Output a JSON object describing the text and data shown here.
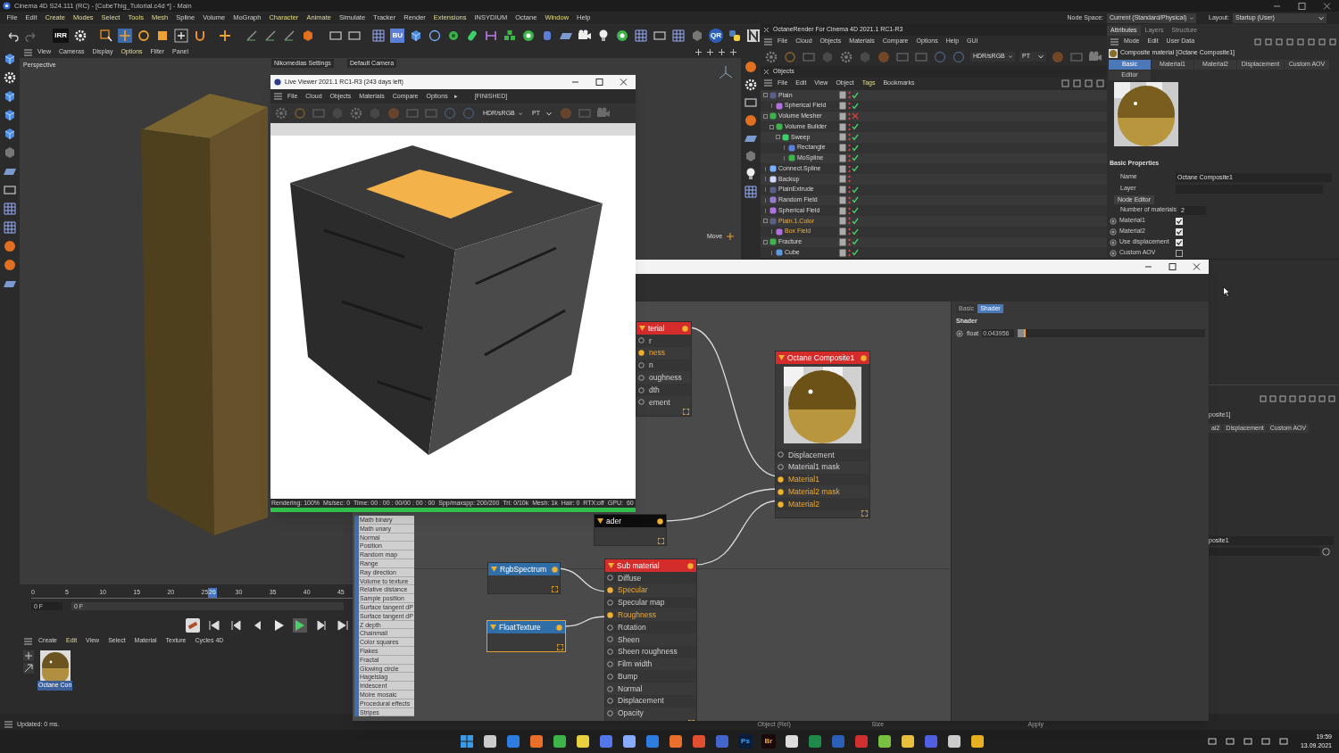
{
  "window": {
    "title": "Cinema 4D S24.111 (RC) - [CubeThig_Tutorial.c4d *] - Main"
  },
  "menu_bar": {
    "items": [
      {
        "label": "File",
        "highlight": false
      },
      {
        "label": "Edit",
        "highlight": false
      },
      {
        "label": "Create",
        "highlight": true
      },
      {
        "label": "Modes",
        "highlight": true
      },
      {
        "label": "Select",
        "highlight": true
      },
      {
        "label": "Tools",
        "highlight": true
      },
      {
        "label": "Mesh",
        "highlight": true
      },
      {
        "label": "Spline",
        "highlight": false
      },
      {
        "label": "Volume",
        "highlight": false
      },
      {
        "label": "MoGraph",
        "highlight": false
      },
      {
        "label": "Character",
        "highlight": true
      },
      {
        "label": "Animate",
        "highlight": true
      },
      {
        "label": "Simulate",
        "highlight": false
      },
      {
        "label": "Tracker",
        "highlight": false
      },
      {
        "label": "Render",
        "highlight": false
      },
      {
        "label": "Extensions",
        "highlight": true
      },
      {
        "label": "INSYDIUM",
        "highlight": false
      },
      {
        "label": "Octane",
        "highlight": false
      },
      {
        "label": "Window",
        "highlight": true
      },
      {
        "label": "Help",
        "highlight": false
      }
    ],
    "node_space_label": "Node Space:",
    "node_space": "Current (Standard/Physical)",
    "layout_label": "Layout:",
    "layout": "Startup (User)"
  },
  "toolbar": {
    "badges": [
      "IRR",
      "BU",
      "QR"
    ]
  },
  "viewport": {
    "menu": [
      {
        "label": "View",
        "highlight": false
      },
      {
        "label": "Cameras",
        "highlight": false
      },
      {
        "label": "Display",
        "highlight": false
      },
      {
        "label": "Options",
        "highlight": true
      },
      {
        "label": "Filter",
        "highlight": false
      },
      {
        "label": "Panel",
        "highlight": false
      }
    ],
    "camera": "Perspective",
    "tabs": [
      "Nikomedias Settings",
      "Default Camera"
    ],
    "move_label": "Move"
  },
  "timeline": {
    "ticks": [
      "0",
      "5",
      "10",
      "15",
      "20",
      "25",
      "30",
      "35",
      "40",
      "45"
    ],
    "current_frame": "26",
    "playhead": {
      "level": 0.52
    },
    "start_field": "0 F",
    "range_field": "0 F"
  },
  "material_manager": {
    "menu": [
      {
        "label": "Create",
        "highlight": false
      },
      {
        "label": "Edit",
        "highlight": true
      },
      {
        "label": "View",
        "highlight": false
      },
      {
        "label": "Select",
        "highlight": false
      },
      {
        "label": "Material",
        "highlight": false
      },
      {
        "label": "Texture",
        "highlight": false
      },
      {
        "label": "Cycles 4D",
        "highlight": false
      }
    ],
    "materials": [
      {
        "name": "Octane Con",
        "selected": true
      }
    ]
  },
  "status_bar": {
    "text": "Updated: 0 ms.",
    "coordinates": [
      "Object (Rel)",
      "Size",
      "Apply"
    ]
  },
  "octane_panel": {
    "title": "OctaneRender For Cinema 4D 2021.1 RC1-R3",
    "menu": [
      "File",
      "Cloud",
      "Objects",
      "Materials",
      "Compare",
      "Options",
      "Help",
      "GUI"
    ],
    "display_mode": "HDR/sRGB",
    "kernel": "PT"
  },
  "objects": {
    "title": "Objects",
    "menu": [
      {
        "label": "File",
        "highlight": false
      },
      {
        "label": "Edit",
        "highlight": false
      },
      {
        "label": "View",
        "highlight": false
      },
      {
        "label": "Object",
        "highlight": false
      },
      {
        "label": "Tags",
        "highlight": true
      },
      {
        "label": "Bookmarks",
        "highlight": false
      }
    ],
    "tree": [
      {
        "name": "Plain",
        "kind": "plain",
        "selected": false,
        "checked": true,
        "disabled": false,
        "children": [
          {
            "name": "Spherical Field",
            "kind": "sphere",
            "selected": false,
            "checked": true,
            "disabled": false
          }
        ]
      },
      {
        "name": "Volume Mesher",
        "kind": "mesher",
        "selected": false,
        "checked": false,
        "disabled": true,
        "children": [
          {
            "name": "Volume Builder",
            "kind": "mesher",
            "selected": false,
            "checked": true,
            "disabled": false,
            "children": [
              {
                "name": "Sweep",
                "kind": "sweep",
                "selected": false,
                "checked": true,
                "disabled": false,
                "children": [
                  {
                    "name": "Rectangle",
                    "kind": "rectangle",
                    "selected": false,
                    "checked": true,
                    "disabled": false
                  },
                  {
                    "name": "MoSpline",
                    "kind": "mospline",
                    "selected": false,
                    "checked": true,
                    "disabled": false
                  }
                ]
              }
            ]
          }
        ]
      },
      {
        "name": "Connect.Spline",
        "kind": "spline",
        "selected": false,
        "checked": true,
        "disabled": false
      },
      {
        "name": "Backup",
        "kind": "null",
        "selected": false,
        "checked": false,
        "disabled": false
      },
      {
        "name": "PlainExtrude",
        "kind": "plain",
        "selected": false,
        "checked": true,
        "disabled": false
      },
      {
        "name": "Random Field",
        "kind": "random",
        "selected": false,
        "checked": true,
        "disabled": false
      },
      {
        "name": "Spherical Field",
        "kind": "sphere",
        "selected": false,
        "checked": true,
        "disabled": false
      },
      {
        "name": "Plain.1.Color",
        "kind": "plain",
        "selected": true,
        "checked": true,
        "disabled": false,
        "children": [
          {
            "name": "Box Field",
            "kind": "box",
            "selected": true,
            "checked": true,
            "disabled": false
          }
        ]
      },
      {
        "name": "Fracture",
        "kind": "fracture",
        "selected": false,
        "checked": true,
        "disabled": false,
        "children": [
          {
            "name": "Cube",
            "kind": "cube",
            "selected": false,
            "checked": true,
            "disabled": false
          }
        ]
      }
    ]
  },
  "attributes": {
    "tabs": [
      {
        "label": "Attributes",
        "selected": true
      },
      {
        "label": "Layers",
        "selected": false
      },
      {
        "label": "Structure",
        "selected": false
      }
    ],
    "menu": [
      "Mode",
      "Edit",
      "User Data"
    ],
    "object_title": "Composite material [Octane Composite1]",
    "material_tabs": [
      {
        "label": "Basic",
        "selected": true
      },
      {
        "label": "Material1",
        "selected": false
      },
      {
        "label": "Material2",
        "selected": false
      },
      {
        "label": "Displacement",
        "selected": false
      },
      {
        "label": "Custom AOV",
        "selected": false
      },
      {
        "label": "Editor",
        "selected": false
      }
    ],
    "section": "Basic Properties",
    "name_label": "Name",
    "name_value": "Octane Composite1",
    "layer_label": "Layer",
    "node_editor_button": "Node Editor",
    "count_label": "Number of materials",
    "count_value": "2",
    "toggles": [
      {
        "label": "Material1",
        "checked": true
      },
      {
        "label": "Material2",
        "checked": true
      },
      {
        "label": "Use displacement",
        "checked": true
      },
      {
        "label": "Custom AOV",
        "checked": false
      }
    ]
  },
  "background_attributes": {
    "title_part": "posite1]",
    "tabs": [
      "al2",
      "Displacement",
      "Custom AOV"
    ],
    "name_part": "posite1"
  },
  "live_viewer": {
    "title": "Live Viewer 2021.1 RC1-R3 (243 days left)",
    "menu": [
      "File",
      "Cloud",
      "Objects",
      "Materials",
      "Compare",
      "Options"
    ],
    "more": "▸",
    "state": "[FINISHED]",
    "display_mode": "HDR/sRGB",
    "kernel": "PT",
    "status": [
      "Rendering: 100%",
      "Ms/sec: 0",
      "Time: 00 : 00 : 00/00 : 00 : 00",
      "Spp/maxspp: 200/200",
      "Tri: 0/10k",
      "Mesh: 1k",
      "Hair: 0",
      "RTX:off",
      "GPU:",
      "60"
    ],
    "progress": {
      "level": 1
    }
  },
  "node_editor": {
    "node_list": [
      "Math binary",
      "Math unary",
      "Normal",
      "Position",
      "Random map",
      "Range",
      "Ray direction",
      "Volume to texture",
      "Relative distance",
      "Sample position",
      "Surface tangent dP",
      "Surface tangent dP",
      "Z depth",
      "Chainmail",
      "Color squares",
      "Flakes",
      "Fractal",
      "Glowing circle",
      "Hagelslag",
      "Iridescent",
      "Moire mosaic",
      "Procedural effects",
      "Stripes"
    ],
    "nodes": [
      {
        "title": "terial",
        "kind": "material",
        "selected": false,
        "preview": false,
        "ports": [
          {
            "label": "r",
            "connected": false
          },
          {
            "label": "ness",
            "connected": true
          },
          {
            "label": "n",
            "connected": false
          },
          {
            "label": "oughness",
            "connected": false
          },
          {
            "label": "dth",
            "connected": false
          },
          {
            "label": "ement",
            "connected": false
          }
        ]
      },
      {
        "title": "Octane Composite1",
        "kind": "material",
        "selected": false,
        "preview": true,
        "ports": [
          {
            "label": "Displacement",
            "connected": false
          },
          {
            "label": "Material1 mask",
            "connected": false
          },
          {
            "label": "Material1",
            "connected": true
          },
          {
            "label": "Material2 mask",
            "connected": true
          },
          {
            "label": "Material2",
            "connected": true
          }
        ]
      },
      {
        "title": "ader",
        "kind": "shader",
        "selected": false,
        "preview": false
      },
      {
        "title": "RgbSpectrum",
        "kind": "texture",
        "selected": false,
        "preview": false
      },
      {
        "title": "FloatTexture",
        "kind": "texture",
        "selected": true,
        "preview": false
      },
      {
        "title": "Sub material",
        "kind": "material",
        "selected": false,
        "preview": false,
        "ports": [
          {
            "label": "Diffuse",
            "connected": false
          },
          {
            "label": "Specular",
            "connected": true
          },
          {
            "label": "Specular map",
            "connected": false
          },
          {
            "label": "Roughness",
            "connected": true
          },
          {
            "label": "Rotation",
            "connected": false
          },
          {
            "label": "Sheen",
            "connected": false
          },
          {
            "label": "Sheen roughness",
            "connected": false
          },
          {
            "label": "Film width",
            "connected": false
          },
          {
            "label": "Bump",
            "connected": false
          },
          {
            "label": "Normal",
            "connected": false
          },
          {
            "label": "Displacement",
            "connected": false
          },
          {
            "label": "Opacity",
            "connected": false
          }
        ]
      }
    ],
    "properties": {
      "tabs": [
        {
          "label": "Basic",
          "selected": false
        },
        {
          "label": "Shader",
          "selected": true
        }
      ],
      "section": "Shader",
      "param_label": "float",
      "param_value": "0.043956",
      "slider": {
        "level": 0.04
      }
    }
  },
  "taskbar": {
    "app_labels": [
      "Ps",
      "Br"
    ],
    "time": "19:59",
    "date": "13.09.2021"
  }
}
